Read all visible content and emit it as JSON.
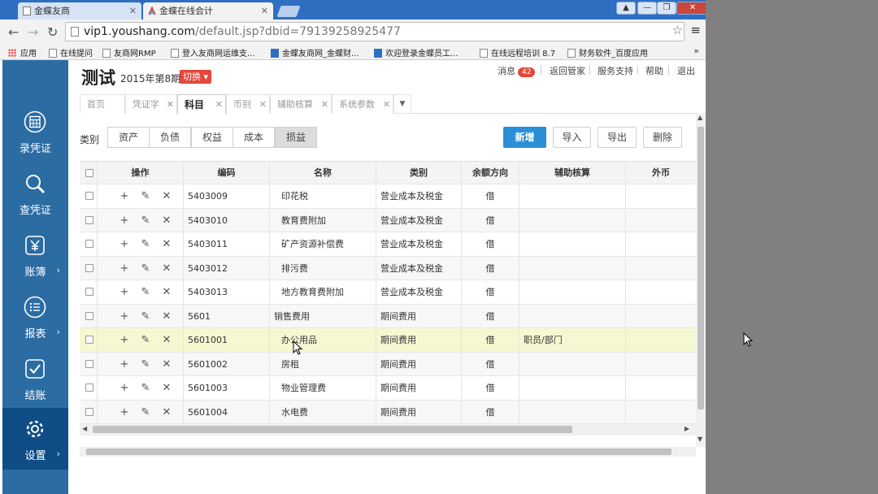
{
  "browser": {
    "tabs": [
      {
        "label": "金蝶友商",
        "active": false
      },
      {
        "label": "金蝶在线会计",
        "active": true
      }
    ],
    "url_host": "vip1.youshang.com",
    "url_path": "/default.jsp?dbid=79139258925477",
    "bookmarks": [
      "应用",
      "在线提问",
      "友商网RMP",
      "登入友商网运维支...",
      "金蝶友商网_金蝶财...",
      "欢迎登录金蝶员工...",
      "在线远程培训 8.7",
      "财务软件_百度应用"
    ],
    "bookmarks_more": "»",
    "window_controls": [
      "▲",
      "—",
      "❐",
      "✕"
    ]
  },
  "sidebar": {
    "items": [
      {
        "label": "录凭证",
        "icon": "calculator-icon",
        "has_arrow": false,
        "active": false
      },
      {
        "label": "查凭证",
        "icon": "search-icon",
        "has_arrow": false,
        "active": false
      },
      {
        "label": "账簿",
        "icon": "yen-icon",
        "has_arrow": true,
        "active": false
      },
      {
        "label": "报表",
        "icon": "list-icon",
        "has_arrow": true,
        "active": false
      },
      {
        "label": "结账",
        "icon": "checkmark-icon",
        "has_arrow": false,
        "active": false
      },
      {
        "label": "设置",
        "icon": "gear-icon",
        "has_arrow": true,
        "active": true
      }
    ],
    "arrow_glyph": "›"
  },
  "header": {
    "title": "测试",
    "period": "2015年第8期",
    "switch_label": "切换",
    "messages_label": "消息",
    "messages_count": "42",
    "links": [
      "返回管家",
      "服务支持",
      "帮助",
      "退出"
    ]
  },
  "subtabs": [
    {
      "label": "首页",
      "closable": false,
      "active": false
    },
    {
      "label": "凭证字",
      "closable": true,
      "active": false
    },
    {
      "label": "科目",
      "closable": true,
      "active": true
    },
    {
      "label": "币别",
      "closable": true,
      "active": false
    },
    {
      "label": "辅助核算",
      "closable": true,
      "active": false
    },
    {
      "label": "系统参数",
      "closable": true,
      "active": false
    }
  ],
  "filter": {
    "label": "类别",
    "categories": [
      "资产",
      "负债",
      "权益",
      "成本",
      "损益"
    ],
    "selected": "损益"
  },
  "actions": {
    "new": "新增",
    "import": "导入",
    "export": "导出",
    "delete": "删除"
  },
  "table": {
    "columns": [
      "操作",
      "编码",
      "名称",
      "类别",
      "余额方向",
      "辅助核算",
      "外币"
    ],
    "op_icons": {
      "add": "+",
      "edit": "✎",
      "delete": "✕"
    },
    "rows": [
      {
        "code": "5403009",
        "name": "印花税",
        "type": "营业成本及税金",
        "direction": "借",
        "aux": "",
        "child": true
      },
      {
        "code": "5403010",
        "name": "教育费附加",
        "type": "营业成本及税金",
        "direction": "借",
        "aux": "",
        "child": true
      },
      {
        "code": "5403011",
        "name": "矿产资源补偿费",
        "type": "营业成本及税金",
        "direction": "借",
        "aux": "",
        "child": true
      },
      {
        "code": "5403012",
        "name": "排污费",
        "type": "营业成本及税金",
        "direction": "借",
        "aux": "",
        "child": true
      },
      {
        "code": "5403013",
        "name": "地方教育费附加",
        "type": "营业成本及税金",
        "direction": "借",
        "aux": "",
        "child": true
      },
      {
        "code": "5601",
        "name": "销售费用",
        "type": "期间费用",
        "direction": "借",
        "aux": "",
        "child": false
      },
      {
        "code": "5601001",
        "name": "办公用品",
        "type": "期间费用",
        "direction": "借",
        "aux": "职员/部门",
        "child": true,
        "highlight": true
      },
      {
        "code": "5601002",
        "name": "房租",
        "type": "期间费用",
        "direction": "借",
        "aux": "",
        "child": true
      },
      {
        "code": "5601003",
        "name": "物业管理费",
        "type": "期间费用",
        "direction": "借",
        "aux": "",
        "child": true
      },
      {
        "code": "5601004",
        "name": "水电费",
        "type": "期间费用",
        "direction": "借",
        "aux": "",
        "child": true
      }
    ]
  }
}
